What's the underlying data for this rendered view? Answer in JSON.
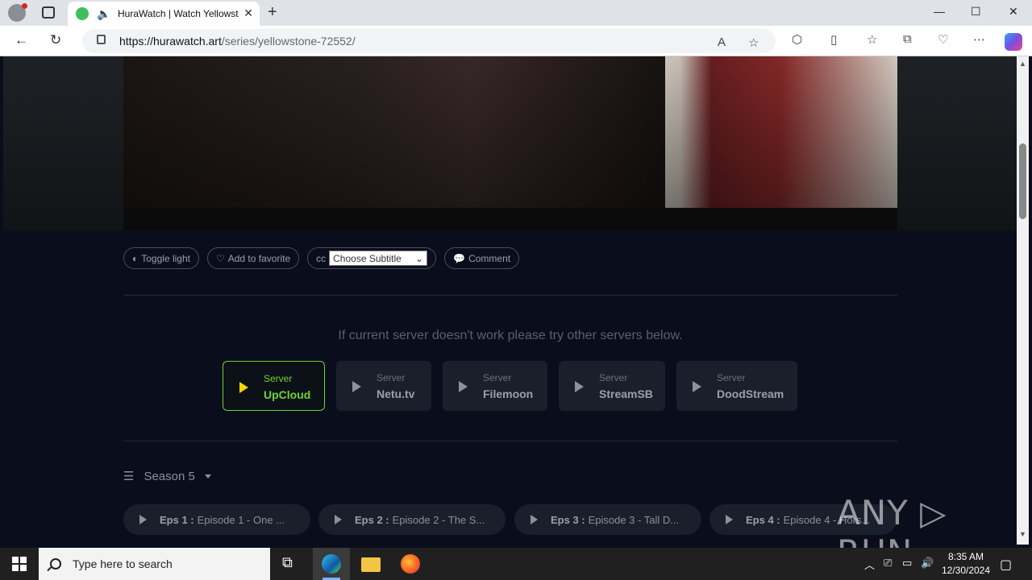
{
  "browser": {
    "tab_title": "HuraWatch | Watch Yellowst",
    "new_tab_symbol": "+",
    "close_tab_symbol": "✕",
    "url_host": "https://hurawatch.art",
    "url_path": "/series/yellowstone-72552/",
    "window_controls": [
      "—",
      "☐",
      "✕"
    ]
  },
  "player": {
    "actions": [
      {
        "icon": "◐",
        "label": "Toggle light"
      },
      {
        "icon": "♡",
        "label": "Add to favorite"
      },
      {
        "icon": "cc",
        "label": "Choose Subtitle"
      },
      {
        "icon": "💬",
        "label": "Comment"
      }
    ]
  },
  "servers": {
    "notice": "If current server doesn't work please try other servers below.",
    "prefix": "Server",
    "items": [
      {
        "name": "UpCloud",
        "active": true
      },
      {
        "name": "Netu.tv",
        "active": false
      },
      {
        "name": "Filemoon",
        "active": false
      },
      {
        "name": "StreamSB",
        "active": false
      },
      {
        "name": "DoodStream",
        "active": false
      }
    ]
  },
  "season": {
    "label": "Season 5"
  },
  "episodes": [
    {
      "num": "Eps 1 :",
      "title": "Episode 1 - One ..."
    },
    {
      "num": "Eps 2 :",
      "title": "Episode 2 - The S..."
    },
    {
      "num": "Eps 3 :",
      "title": "Episode 3 - Tall D..."
    },
    {
      "num": "Eps 4 :",
      "title": "Episode 4 - Hors..."
    }
  ],
  "watermark": "ANY ▷ RUN",
  "taskbar": {
    "search_placeholder": "Type here to search",
    "time": "8:35 AM",
    "date": "12/30/2024"
  }
}
